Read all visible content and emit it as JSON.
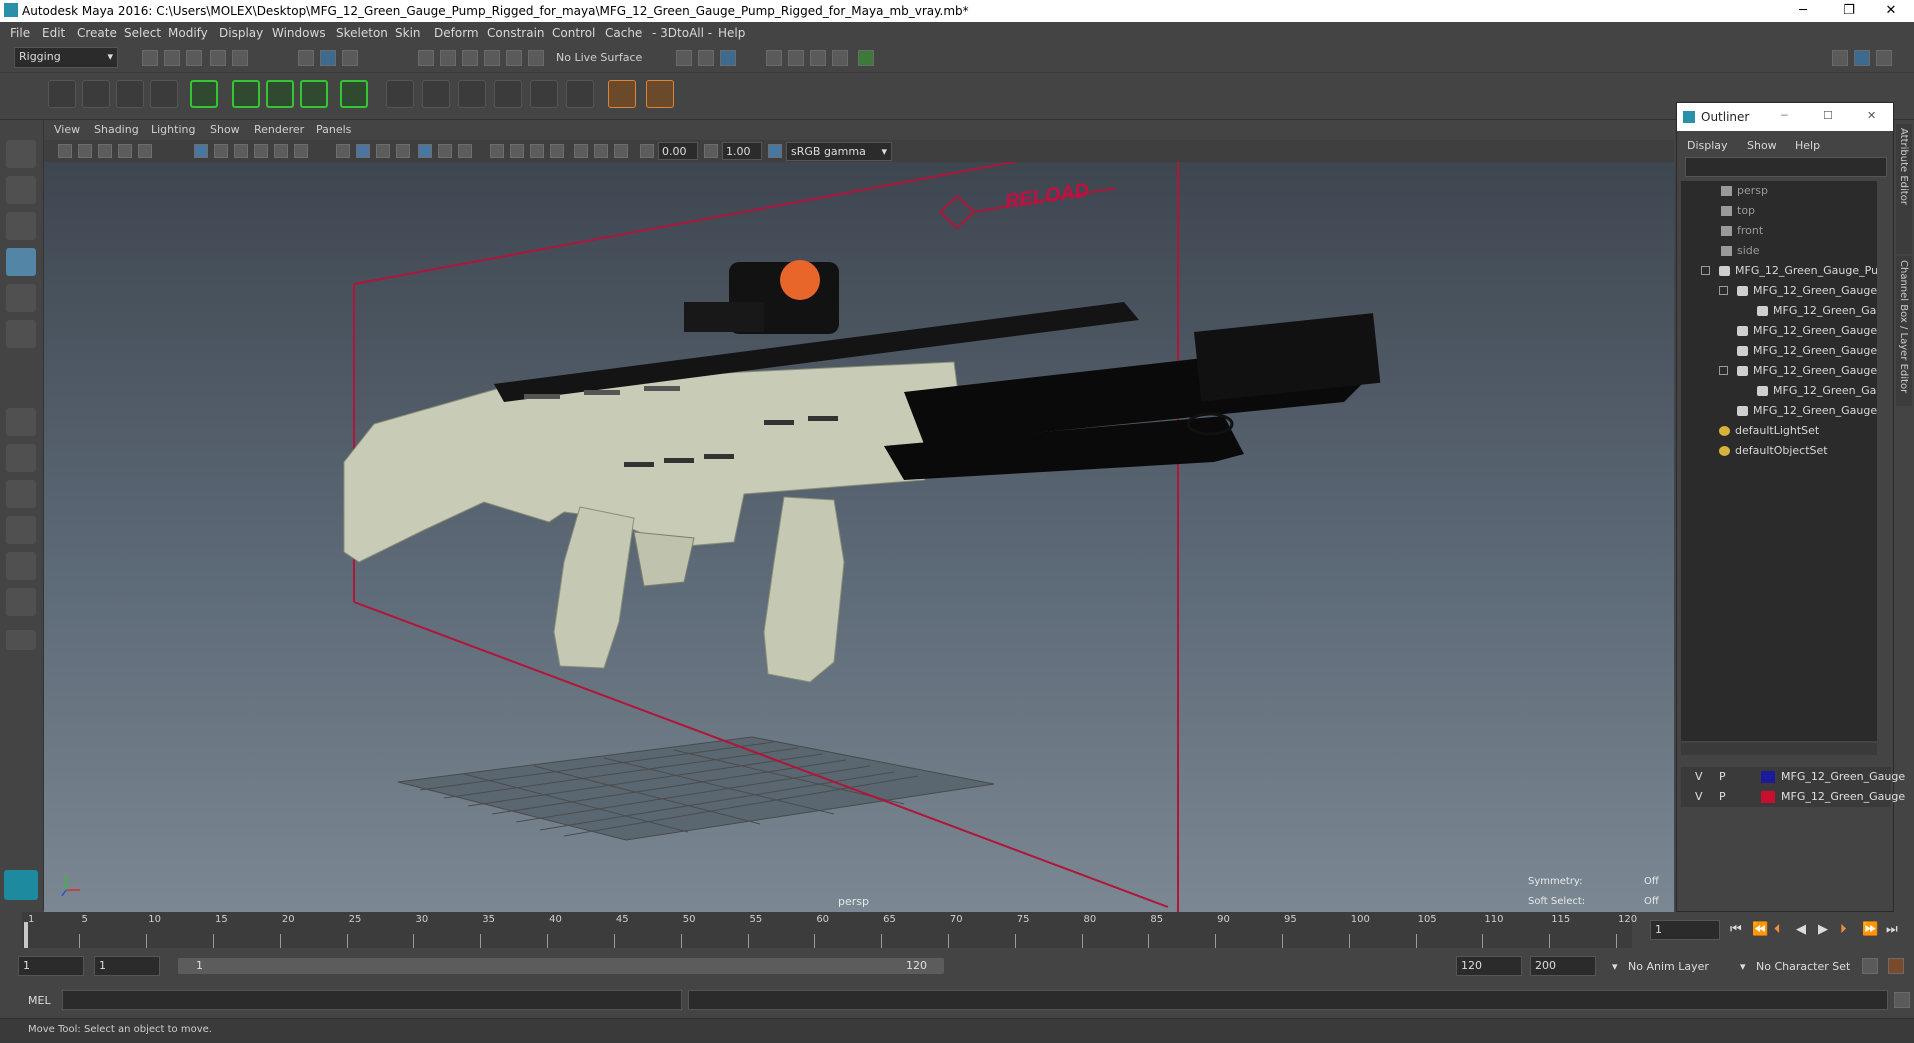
{
  "window": {
    "title": "Autodesk Maya 2016: C:\\Users\\MOLEX\\Desktop\\MFG_12_Green_Gauge_Pump_Rigged_for_maya\\MFG_12_Green_Gauge_Pump_Rigged_for_Maya_mb_vray.mb*",
    "minimize": "─",
    "restore": "❐",
    "close": "✕"
  },
  "menubar": [
    "File",
    "Edit",
    "Create",
    "Select",
    "Modify",
    "Display",
    "Windows",
    "Skeleton",
    "Skin",
    "Deform",
    "Constrain",
    "Control",
    "Cache",
    "- 3DtoAll -",
    "Help"
  ],
  "statusline": {
    "mode": "Rigging",
    "live_surface": "No Live Surface"
  },
  "panel": {
    "menus": [
      "View",
      "Shading",
      "Lighting",
      "Show",
      "Renderer",
      "Panels"
    ],
    "exposure": "0.00",
    "gamma": "1.00",
    "colorspace": "sRGB gamma",
    "camera_label": "persp",
    "hud": {
      "symmetry_label": "Symmetry:",
      "symmetry_value": "Off",
      "soft_select_label": "Soft Select:",
      "soft_select_value": "Off"
    },
    "annotation": "RELOAD"
  },
  "outliner": {
    "title": "Outliner",
    "menus": [
      "Display",
      "Show",
      "Help"
    ],
    "items": [
      {
        "label": "persp",
        "type": "camera"
      },
      {
        "label": "top",
        "type": "camera"
      },
      {
        "label": "front",
        "type": "camera"
      },
      {
        "label": "side",
        "type": "camera"
      },
      {
        "label": "MFG_12_Green_Gauge_Pur",
        "type": "mesh"
      },
      {
        "label": "MFG_12_Green_Gauge",
        "type": "mesh"
      },
      {
        "label": "MFG_12_Green_Ga",
        "type": "mesh"
      },
      {
        "label": "MFG_12_Green_Gauge",
        "type": "mesh"
      },
      {
        "label": "MFG_12_Green_Gauge",
        "type": "mesh"
      },
      {
        "label": "MFG_12_Green_Gauge",
        "type": "mesh"
      },
      {
        "label": "MFG_12_Green_Ga",
        "type": "mesh"
      },
      {
        "label": "MFG_12_Green_Gauge",
        "type": "mesh"
      },
      {
        "label": "defaultLightSet",
        "type": "set"
      },
      {
        "label": "defaultObjectSet",
        "type": "set"
      }
    ],
    "layers": [
      {
        "v": "V",
        "p": "P",
        "color": "#1a1a9a",
        "name": "MFG_12_Green_Gauge"
      },
      {
        "v": "V",
        "p": "P",
        "color": "#c8102e",
        "name": "MFG_12_Green_Gauge"
      }
    ]
  },
  "side_tabs": {
    "attribute_editor": "Attribute Editor",
    "channel_box": "Channel Box / Layer Editor"
  },
  "timeline": {
    "ticks": [
      "1",
      "5",
      "10",
      "15",
      "20",
      "25",
      "30",
      "35",
      "40",
      "45",
      "50",
      "55",
      "60",
      "65",
      "70",
      "75",
      "80",
      "85",
      "90",
      "95",
      "100",
      "105",
      "110",
      "115",
      "120"
    ],
    "current_frame": "1"
  },
  "range": {
    "start": "1",
    "playback_start": "1",
    "slider_start": "1",
    "slider_end": "120",
    "playback_end": "120",
    "end": "200",
    "anim_layer": "No Anim Layer",
    "character_set": "No Character Set"
  },
  "cmdline": {
    "lang": "MEL"
  },
  "helpline": {
    "text": "Move Tool: Select an object to move."
  }
}
